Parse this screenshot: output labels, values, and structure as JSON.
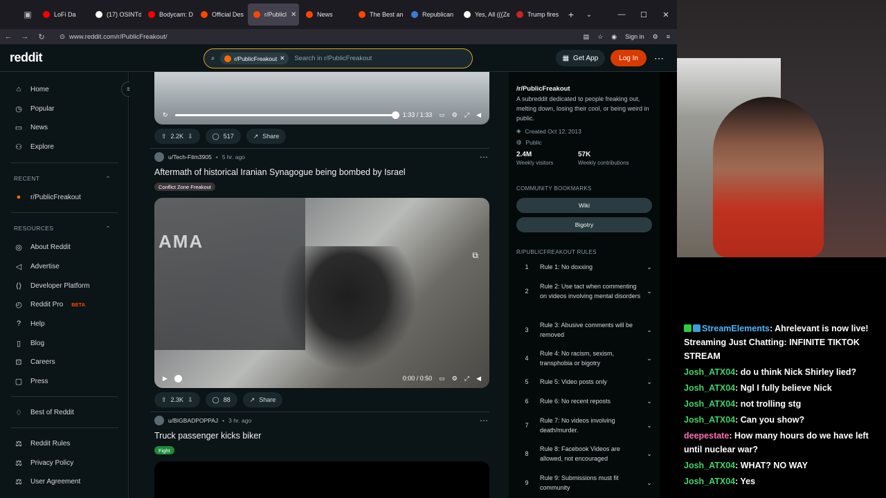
{
  "browser": {
    "tabs": [
      {
        "title": "LoFi Da",
        "color": "#ff0000"
      },
      {
        "title": "(17) OSINTd",
        "color": "#ffffff"
      },
      {
        "title": "Bodycam: D",
        "color": "#ff0000"
      },
      {
        "title": "Official Des",
        "color": "#ff4500"
      },
      {
        "title": "r/Publicl",
        "color": "#ff4500"
      },
      {
        "title": "News",
        "color": "#ff4500"
      },
      {
        "title": "The Best an",
        "color": "#ff4500"
      },
      {
        "title": "Republican",
        "color": "#3a7bd5"
      },
      {
        "title": "Yes, All (((Ze",
        "color": "#ffffff"
      },
      {
        "title": "Trump fires",
        "color": "#cc2222"
      }
    ],
    "url": "www.reddit.com/r/PublicFreakout/",
    "signin": "Sign in"
  },
  "header": {
    "logo": "reddit",
    "search_chip": "r/PublicFreakout",
    "search_placeholder": "Search in r/PublicFreakout",
    "get_app": "Get App",
    "login": "Log In"
  },
  "sidebar": {
    "main": [
      {
        "label": "Home",
        "icon": "home-icon"
      },
      {
        "label": "Popular",
        "icon": "popular-icon"
      },
      {
        "label": "News",
        "icon": "news-icon"
      },
      {
        "label": "Explore",
        "icon": "explore-icon"
      }
    ],
    "recent_title": "RECENT",
    "recent_item": "r/PublicFreakout",
    "resources_title": "RESOURCES",
    "resources": [
      {
        "label": "About Reddit"
      },
      {
        "label": "Advertise"
      },
      {
        "label": "Developer Platform"
      },
      {
        "label": "Reddit Pro",
        "badge": "BETA"
      },
      {
        "label": "Help"
      },
      {
        "label": "Blog"
      },
      {
        "label": "Careers"
      },
      {
        "label": "Press"
      }
    ],
    "best": "Best of Reddit",
    "legal": [
      "Reddit Rules",
      "Privacy Policy",
      "User Agreement"
    ]
  },
  "feed": {
    "top_video": {
      "time": "1:33 / 1:33",
      "progress": 1.0
    },
    "top_actions": {
      "votes": "2.2K",
      "comments": "517",
      "share": "Share"
    },
    "post1": {
      "user": "u/Tech-Film3905",
      "age": "5 hr. ago",
      "title": "Aftermath of historical Iranian Synagogue being bombed by Israel",
      "flair": "Conflict Zone Freakout",
      "video_text": "AMA",
      "time": "0:00 / 0:50",
      "votes": "2.3K",
      "comments": "88",
      "share": "Share"
    },
    "post2": {
      "user": "u/BIGBADPOPPAJ",
      "age": "3 hr. ago",
      "title": "Truck passenger kicks biker",
      "flair": "Fight"
    }
  },
  "community": {
    "name": "/r/PublicFreakout",
    "description": "A subreddit dedicated to people freaking out, melting down, losing their cool, or being weird in public.",
    "created": "Created Oct 12, 2013",
    "visibility": "Public",
    "visitors": "2.4M",
    "visitors_label": "Weekly visitors",
    "contributions": "57K",
    "contributions_label": "Weekly contributions",
    "bookmarks_title": "COMMUNITY BOOKMARKS",
    "bookmarks": [
      "Wiki",
      "Bigotry"
    ],
    "rules_title": "R/PUBLICFREAKOUT RULES",
    "rules": [
      {
        "n": "1",
        "t": "Rule 1: No doxxing"
      },
      {
        "n": "2",
        "t": "Rule 2: Use tact when commenting on videos involving mental disorders"
      },
      {
        "n": "3",
        "t": "Rule 3: Abusive comments will be removed"
      },
      {
        "n": "4",
        "t": "Rule 4: No racism, sexism, transphobia or bigotry"
      },
      {
        "n": "5",
        "t": "Rule 5: Video posts only"
      },
      {
        "n": "6",
        "t": "Rule 6: No recent reposts"
      },
      {
        "n": "7",
        "t": "Rule 7: No videos involving death/murder."
      },
      {
        "n": "8",
        "t": "Rule 8: Facebook Videos are allowed, not encouraged"
      },
      {
        "n": "9",
        "t": "Rule 9: Submissions must fit community"
      }
    ]
  },
  "chat": [
    {
      "user": "StreamElements",
      "color": "#4db6ff",
      "msg": ": Ahrelevant is now live! Streaming Just Chatting: INFINITE TIKTOK STREAM"
    },
    {
      "user": "Josh_ATX04",
      "color": "#3fd46a",
      "msg": ": do u think Nick Shirley lied?"
    },
    {
      "user": "Josh_ATX04",
      "color": "#3fd46a",
      "msg": ": Ngl I fully believe Nick"
    },
    {
      "user": "Josh_ATX04",
      "color": "#3fd46a",
      "msg": ": not trolling stg"
    },
    {
      "user": "Josh_ATX04",
      "color": "#3fd46a",
      "msg": ": Can you show?"
    },
    {
      "user": "deepestate",
      "color": "#ff6fb5",
      "msg": ": How many hours do we have left until nuclear war?"
    },
    {
      "user": "Josh_ATX04",
      "color": "#3fd46a",
      "msg": ": WHAT? NO WAY"
    },
    {
      "user": "Josh_ATX04",
      "color": "#3fd46a",
      "msg": ": Yes"
    }
  ]
}
